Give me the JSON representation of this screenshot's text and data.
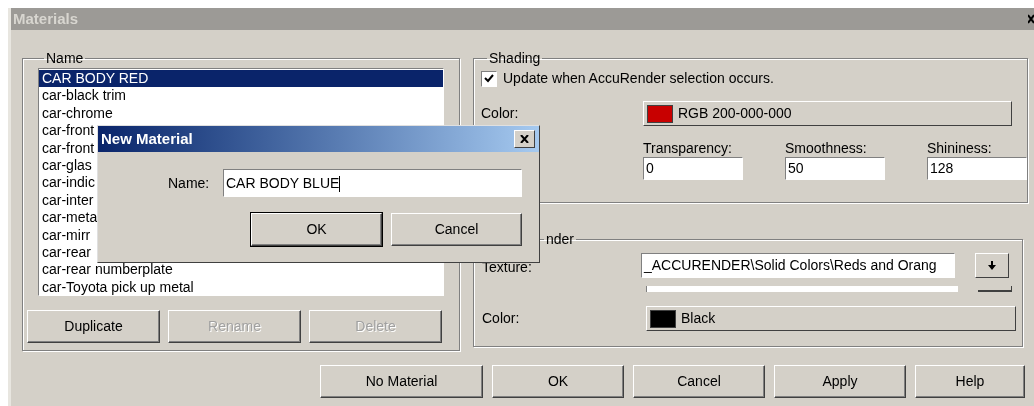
{
  "window": {
    "title": "Materials"
  },
  "name_group": {
    "title": "Name",
    "items": [
      {
        "label": "CAR BODY RED",
        "selected": true
      },
      {
        "label": "car-black trim",
        "selected": false
      },
      {
        "label": "car-chrome",
        "selected": false
      },
      {
        "label": "car-front",
        "selected": false
      },
      {
        "label": "car-front",
        "selected": false
      },
      {
        "label": "car-glas",
        "selected": false
      },
      {
        "label": "car-indic",
        "selected": false
      },
      {
        "label": "car-inter",
        "selected": false
      },
      {
        "label": "car-meta",
        "selected": false
      },
      {
        "label": "car-mirr",
        "selected": false
      },
      {
        "label": "car-rear",
        "selected": false
      },
      {
        "label": "car-rear numberplate",
        "selected": false
      },
      {
        "label": "car-Toyota pick up metal",
        "selected": false
      }
    ],
    "buttons": [
      {
        "label": "Duplicate",
        "disabled": false
      },
      {
        "label": "Rename",
        "disabled": true
      },
      {
        "label": "Delete",
        "disabled": true
      }
    ]
  },
  "shading": {
    "title": "Shading",
    "update_checkbox": {
      "label": "Update when AccuRender selection occurs.",
      "checked": true
    },
    "color": {
      "label": "Color:",
      "value": "RGB 200-000-000",
      "color": "#c80000"
    },
    "fields": [
      {
        "label": "Transparency:",
        "value": "0"
      },
      {
        "label": "Smoothness:",
        "value": "50"
      },
      {
        "label": "Shininess:",
        "value": "128"
      }
    ]
  },
  "accurender": {
    "title": "nder",
    "texture": {
      "label": "Texture:",
      "value": "_ACCURENDER\\Solid Colors\\Reds and Orang"
    },
    "color": {
      "label": "Color:",
      "value": "Black",
      "color": "#000000"
    }
  },
  "footer_buttons": [
    "No Material",
    "OK",
    "Cancel",
    "Apply",
    "Help"
  ],
  "dialog": {
    "title": "New Material",
    "name_label": "Name:",
    "name_value": "CAR BODY BLUE",
    "buttons": [
      {
        "label": "OK",
        "default": true
      },
      {
        "label": "Cancel",
        "default": false
      }
    ]
  }
}
